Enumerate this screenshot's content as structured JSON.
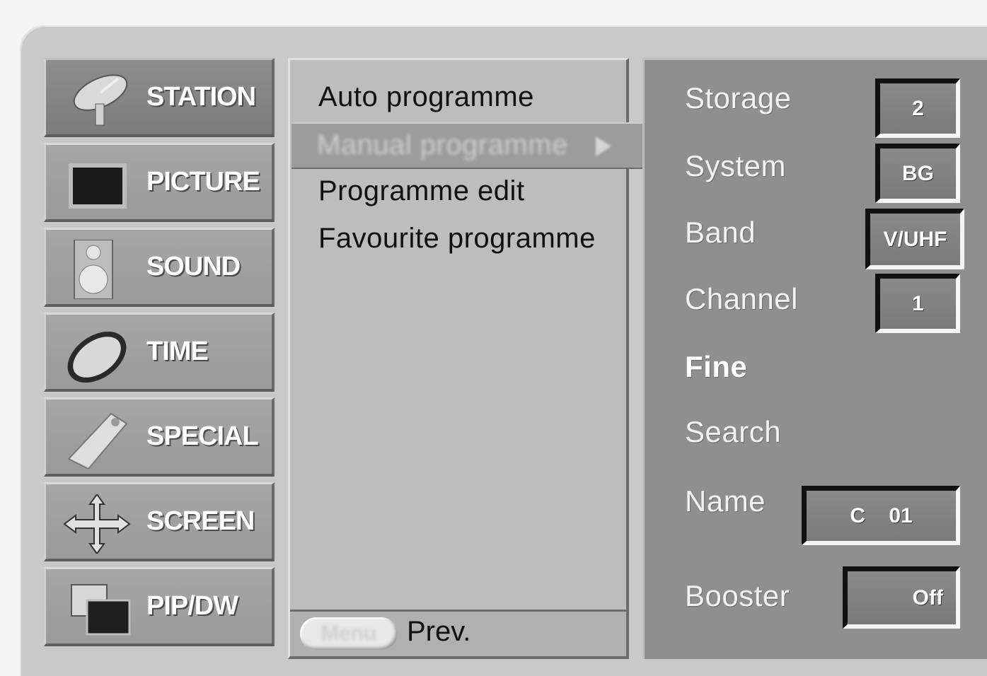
{
  "main_menu": [
    {
      "label": "STATION",
      "icon": "satellite-dish-icon",
      "active": true
    },
    {
      "label": "PICTURE",
      "icon": "tv-screen-icon"
    },
    {
      "label": "SOUND",
      "icon": "speaker-icon"
    },
    {
      "label": "TIME",
      "icon": "clock-icon"
    },
    {
      "label": "SPECIAL",
      "icon": "tag-icon"
    },
    {
      "label": "SCREEN",
      "icon": "move-arrows-icon"
    },
    {
      "label": "PIP/DW",
      "icon": "pip-windows-icon"
    }
  ],
  "submenu": {
    "items": [
      "Auto programme",
      "Manual programme",
      "Programme edit",
      "Favourite programme"
    ],
    "selected_index": 1,
    "footer": {
      "button_label": "Menu",
      "action_label": "Prev."
    }
  },
  "settings": {
    "storage": {
      "label": "Storage",
      "value": "2"
    },
    "system": {
      "label": "System",
      "value": "BG"
    },
    "band": {
      "label": "Band",
      "value": "V/UHF"
    },
    "channel": {
      "label": "Channel",
      "value": "1"
    },
    "fine": {
      "label": "Fine"
    },
    "search": {
      "label": "Search"
    },
    "name": {
      "label": "Name",
      "value": "C    01"
    },
    "booster": {
      "label": "Booster",
      "value": "Off"
    }
  }
}
